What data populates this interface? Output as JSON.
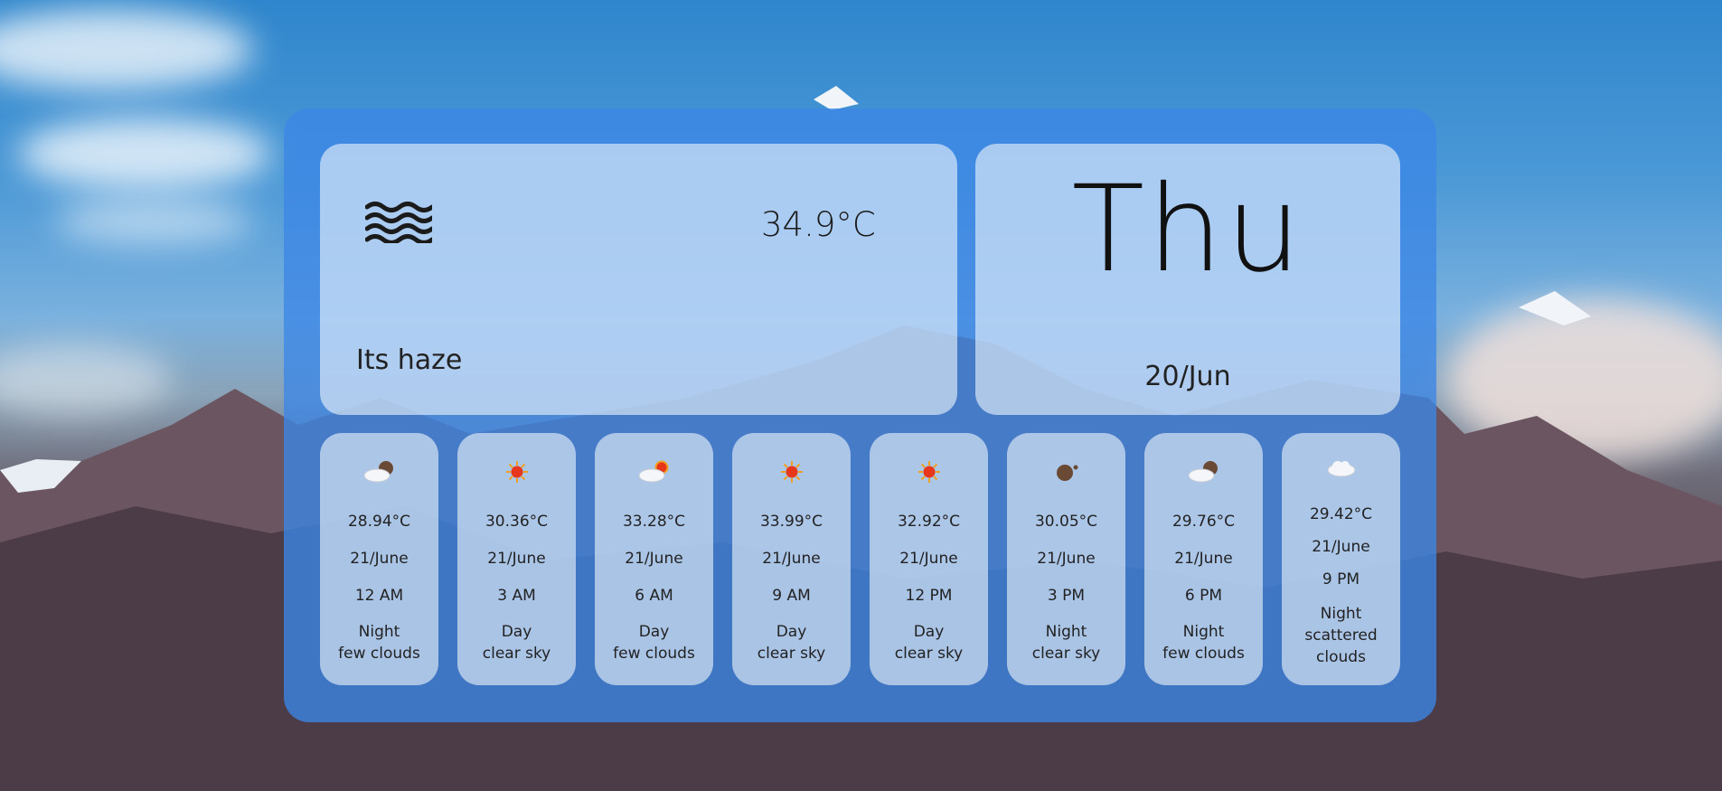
{
  "current": {
    "icon": "haze-icon",
    "temperature": "34.9°C",
    "description": "Its haze"
  },
  "day": {
    "name": "Thu",
    "date": "20/Jun"
  },
  "forecast": [
    {
      "icon": "night-few-clouds-icon",
      "temp": "28.94°C",
      "date": "21/June",
      "time": "12 AM",
      "period": "Night",
      "condition": "few clouds"
    },
    {
      "icon": "sun-icon",
      "temp": "30.36°C",
      "date": "21/June",
      "time": "3 AM",
      "period": "Day",
      "condition": "clear sky"
    },
    {
      "icon": "day-few-clouds-icon",
      "temp": "33.28°C",
      "date": "21/June",
      "time": "6 AM",
      "period": "Day",
      "condition": "few clouds"
    },
    {
      "icon": "sun-icon",
      "temp": "33.99°C",
      "date": "21/June",
      "time": "9 AM",
      "period": "Day",
      "condition": "clear sky"
    },
    {
      "icon": "sun-icon",
      "temp": "32.92°C",
      "date": "21/June",
      "time": "12 PM",
      "period": "Day",
      "condition": "clear sky"
    },
    {
      "icon": "moon-icon",
      "temp": "30.05°C",
      "date": "21/June",
      "time": "3 PM",
      "period": "Night",
      "condition": "clear sky"
    },
    {
      "icon": "night-few-clouds-icon",
      "temp": "29.76°C",
      "date": "21/June",
      "time": "6 PM",
      "period": "Night",
      "condition": "few clouds"
    },
    {
      "icon": "cloud-icon",
      "temp": "29.42°C",
      "date": "21/June",
      "time": "9 PM",
      "period": "Night",
      "condition": "scattered clouds"
    }
  ],
  "colors": {
    "panel": "#3c87e6",
    "card": "#ebf3fc",
    "sun": "#e8361a"
  }
}
